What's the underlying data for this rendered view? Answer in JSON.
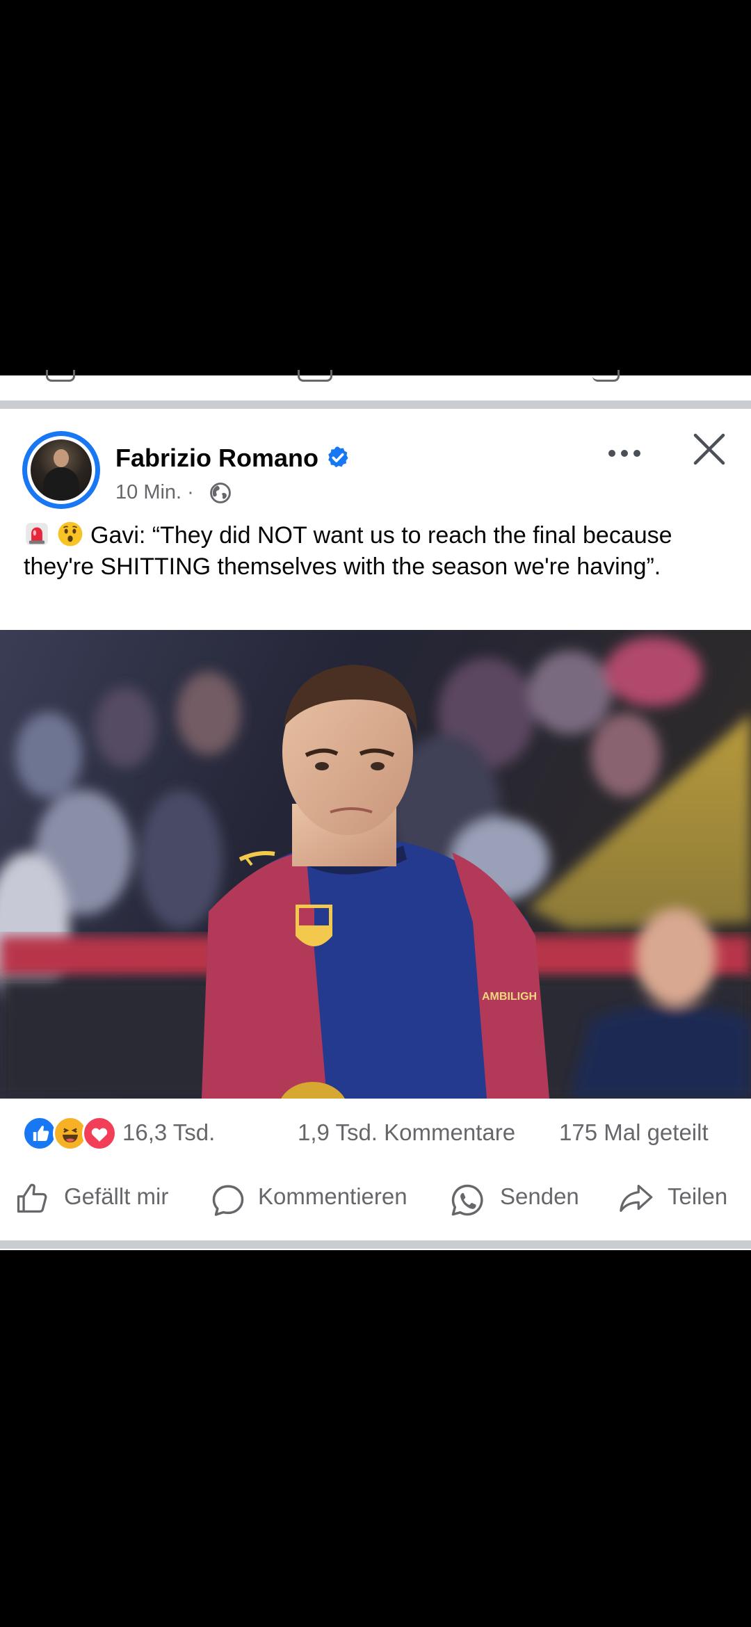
{
  "post": {
    "author": "Fabrizio Romano",
    "time": "10 Min. ·",
    "text": "Gavi: “They did NOT want us to reach the final because they're SHITTING themselves with the season we're having”.",
    "image": {
      "jersey_sponsor_text": "AMBILIGH"
    }
  },
  "stats": {
    "reactions": "16,3 Tsd.",
    "comments": "1,9 Tsd. Kommentare",
    "shares": "175 Mal geteilt"
  },
  "actions": {
    "like": "Gefällt mir",
    "comment": "Kommentieren",
    "send": "Senden",
    "share": "Teilen"
  },
  "icons": {
    "verified": "verified-badge-icon",
    "globe": "globe-icon",
    "more": "more-dots-icon",
    "close": "close-icon",
    "siren": "siren-emoji-icon",
    "astonished": "astonished-face-emoji-icon",
    "like_reaction": "like-reaction-icon",
    "haha_reaction": "haha-reaction-icon",
    "love_reaction": "love-reaction-icon",
    "thumb": "thumbs-up-icon",
    "bubble": "comment-bubble-icon",
    "whatsapp": "whatsapp-icon",
    "share_arrow": "share-arrow-icon"
  },
  "colors": {
    "brand_blue": "#1877f2",
    "text_primary": "#050505",
    "text_secondary": "#65676b",
    "separator": "#c9ccd1",
    "love_red": "#f33e58",
    "haha_yellow": "#f7b125"
  }
}
